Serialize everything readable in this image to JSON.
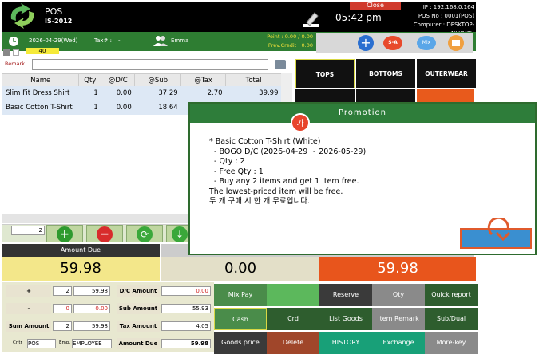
{
  "header": {
    "app_name": "POS",
    "app_version": "IS-2012",
    "close_label": "Close",
    "time": "05:42 pm",
    "ip": "IP : 192.168.0.164",
    "pos_no": "POS No : 0001(POS)",
    "computer": "Computer : DESKTOP-NLKM3V"
  },
  "status_bar": {
    "date": "2026-04-29(Wed)",
    "tax_label": "Tax# :",
    "tax_value": "-",
    "user": "Emma",
    "point": "Point : 0.00 / 0.00",
    "prev_credit": "Prev.Credit : 0.00",
    "counter": "40",
    "btn_sa": "S-A",
    "btn_mix": "Mix"
  },
  "remark": {
    "label": "Remark"
  },
  "cart": {
    "columns": [
      "Name",
      "Qty",
      "@D/C",
      "@Sub",
      "@Tax",
      "Total"
    ],
    "rows": [
      [
        "Slim Fit Dress Shirt",
        "1",
        "0.00",
        "37.29",
        "2.70",
        "39.99"
      ],
      [
        "Basic Cotton T-Shirt",
        "1",
        "0.00",
        "18.64",
        "",
        ""
      ]
    ]
  },
  "categories": [
    "TOPS",
    "BOTTOMS",
    "OUTERWEAR"
  ],
  "qty_field": "2",
  "amounts": {
    "label": "Amount Due",
    "due": "59.98",
    "paid": "0.00",
    "change": "59.98"
  },
  "left_panel": {
    "plus_label": "+",
    "minus_label": "-",
    "plus_qty": "2",
    "plus_amt": "59.98",
    "minus_qty": "0",
    "minus_amt": "0.00",
    "sum_label": "Sum Amount",
    "sum_qty": "2",
    "sum_amt": "59.98",
    "cntr_label": "Cntr",
    "cntr_val": "POS",
    "emp_label": "Emp.",
    "emp_val": "EMPLOYEE",
    "dc_label": "D/C Amount",
    "dc_val": "0.00",
    "sub_label": "Sub Amount",
    "sub_val": "55.93",
    "tax_label": "Tax Amount",
    "tax_val": "4.05",
    "due_label": "Amount Due",
    "due_val": "59.98"
  },
  "buttons": {
    "mix_pay": "Mix Pay",
    "reserve": "Reserve",
    "qty": "Qty",
    "quick_report": "Quick report",
    "cash": "Cash",
    "crd": "Crd",
    "list_goods": "List Goods",
    "item_remark": "Item Remark",
    "sub_dual": "Sub/Dual",
    "goods_price": "Goods price",
    "delete": "Delete",
    "history": "HISTORY",
    "exchange": "Exchange",
    "more_key": "More-key"
  },
  "dialog": {
    "title": "Promotion",
    "badge": "가",
    "lines": [
      "* Basic Cotton T-Shirt (White)",
      "  - BOGO D/C (2026-04-29 ~ 2026-05-29)",
      "  - Qty : 2",
      "  - Free Qty : 1",
      "  - Buy any 2 items and get 1 item free.",
      "The lowest-priced item will be free.",
      "두 개 구매 시 한 개 무료입니다."
    ]
  }
}
